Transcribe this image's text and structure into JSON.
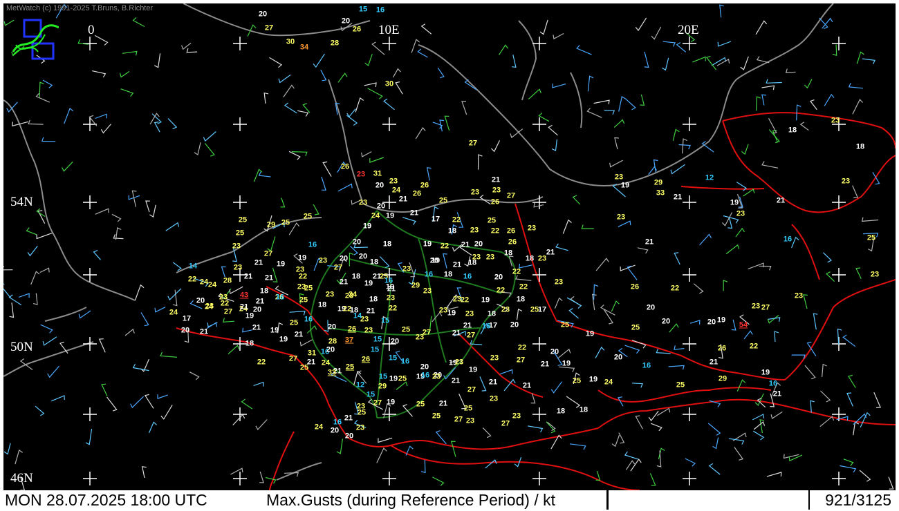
{
  "credit": "MetWatch  (c) 1991-2025 T.Bruns, B.Richter",
  "footer": {
    "datetime": "MON 28.07.2025 18:00 UTC",
    "parameter": "Max.Gusts (during Reference Period) / kt",
    "station_count": "921/3125"
  },
  "grid_labels": {
    "lon_0": "0",
    "lon_10e": "10E",
    "lon_20e": "20E",
    "lat_54n": "54N",
    "lat_50n": "50N",
    "lat_46n": "46N"
  },
  "legend_colors": {
    "below_20": "#ffffff",
    "20_to_34": "#ffff66",
    "34_to_48": "#ff9933",
    "48_plus": "#ff3333",
    "calm_marine": "#33ccff"
  },
  "observations": [
    {
      "v": "20",
      "c": "w"
    },
    {
      "v": "27",
      "c": "y"
    },
    {
      "v": "30",
      "c": "y"
    },
    {
      "v": "34",
      "c": "o"
    },
    {
      "v": "28",
      "c": "y"
    },
    {
      "v": "20",
      "c": "w"
    },
    {
      "v": "26",
      "c": "y"
    },
    {
      "v": "15",
      "c": "c"
    },
    {
      "v": "16",
      "c": "c"
    },
    {
      "v": "30",
      "c": "y"
    },
    {
      "v": "27",
      "c": "y"
    },
    {
      "v": "26",
      "c": "y"
    },
    {
      "v": "23",
      "c": "r"
    },
    {
      "v": "31",
      "c": "y"
    },
    {
      "v": "20",
      "c": "w"
    },
    {
      "v": "23",
      "c": "y"
    },
    {
      "v": "24",
      "c": "y"
    },
    {
      "v": "26",
      "c": "y"
    },
    {
      "v": "26",
      "c": "y"
    },
    {
      "v": "21",
      "c": "w"
    },
    {
      "v": "23",
      "c": "y"
    },
    {
      "v": "23",
      "c": "y"
    },
    {
      "v": "27",
      "c": "y"
    },
    {
      "v": "25",
      "c": "y"
    },
    {
      "v": "21",
      "c": "w"
    },
    {
      "v": "23",
      "c": "y"
    },
    {
      "v": "20",
      "c": "w"
    },
    {
      "v": "24",
      "c": "y"
    },
    {
      "v": "19",
      "c": "w"
    },
    {
      "v": "21",
      "c": "w"
    },
    {
      "v": "26",
      "c": "y"
    },
    {
      "v": "23",
      "c": "y"
    },
    {
      "v": "19",
      "c": "w"
    },
    {
      "v": "29",
      "c": "y"
    },
    {
      "v": "33",
      "c": "y"
    },
    {
      "v": "21",
      "c": "w"
    },
    {
      "v": "12",
      "c": "c"
    },
    {
      "v": "18",
      "c": "w"
    },
    {
      "v": "23",
      "c": "y"
    },
    {
      "v": "18",
      "c": "w"
    },
    {
      "v": "23",
      "c": "y"
    },
    {
      "v": "19",
      "c": "w"
    },
    {
      "v": "23",
      "c": "y"
    },
    {
      "v": "21",
      "c": "w"
    },
    {
      "v": "25",
      "c": "y"
    },
    {
      "v": "25",
      "c": "y"
    },
    {
      "v": "29",
      "c": "y"
    },
    {
      "v": "25",
      "c": "y"
    },
    {
      "v": "25",
      "c": "y"
    },
    {
      "v": "23",
      "c": "y"
    },
    {
      "v": "20",
      "c": "w"
    },
    {
      "v": "19",
      "c": "w"
    },
    {
      "v": "17",
      "c": "w"
    },
    {
      "v": "22",
      "c": "y"
    },
    {
      "v": "25",
      "c": "y"
    },
    {
      "v": "18",
      "c": "w"
    },
    {
      "v": "23",
      "c": "y"
    },
    {
      "v": "22",
      "c": "y"
    },
    {
      "v": "26",
      "c": "y"
    },
    {
      "v": "23",
      "c": "y"
    },
    {
      "v": "16",
      "c": "c"
    },
    {
      "v": "20",
      "c": "w"
    },
    {
      "v": "18",
      "c": "w"
    },
    {
      "v": "19",
      "c": "w"
    },
    {
      "v": "22",
      "c": "y"
    },
    {
      "v": "21",
      "c": "w"
    },
    {
      "v": "20",
      "c": "w"
    },
    {
      "v": "26",
      "c": "y"
    },
    {
      "v": "21",
      "c": "w"
    },
    {
      "v": "21",
      "c": "w"
    },
    {
      "v": "16",
      "c": "c"
    },
    {
      "v": "25",
      "c": "y"
    },
    {
      "v": "14",
      "c": "c"
    },
    {
      "v": "23",
      "c": "y"
    },
    {
      "v": "27",
      "c": "y"
    },
    {
      "v": "21",
      "c": "w"
    },
    {
      "v": "19",
      "c": "w"
    },
    {
      "v": "19",
      "c": "w"
    },
    {
      "v": "23",
      "c": "y"
    },
    {
      "v": "27",
      "c": "y"
    },
    {
      "v": "20",
      "c": "w"
    },
    {
      "v": "18",
      "c": "w"
    },
    {
      "v": "23",
      "c": "y"
    },
    {
      "v": "20",
      "c": "w"
    },
    {
      "v": "21",
      "c": "w"
    },
    {
      "v": "23",
      "c": "y"
    },
    {
      "v": "18",
      "c": "w"
    },
    {
      "v": "18",
      "c": "w"
    },
    {
      "v": "18",
      "c": "w"
    },
    {
      "v": "23",
      "c": "y"
    },
    {
      "v": "21",
      "c": "w"
    },
    {
      "v": "21",
      "c": "w"
    },
    {
      "v": "28",
      "c": "y"
    },
    {
      "v": "22",
      "c": "y"
    },
    {
      "v": "24",
      "c": "y"
    },
    {
      "v": "24",
      "c": "y"
    },
    {
      "v": "18",
      "c": "w"
    },
    {
      "v": "22",
      "c": "y"
    },
    {
      "v": "26",
      "c": "y"
    },
    {
      "v": "23",
      "c": "y"
    },
    {
      "v": "21",
      "c": "w"
    },
    {
      "v": "23",
      "c": "y"
    },
    {
      "v": "25",
      "c": "y"
    },
    {
      "v": "23",
      "c": "y"
    },
    {
      "v": "25",
      "c": "y"
    },
    {
      "v": "23",
      "c": "y"
    },
    {
      "v": "18",
      "c": "w"
    },
    {
      "v": "19",
      "c": "w"
    },
    {
      "v": "16",
      "c": "c"
    },
    {
      "v": "21",
      "c": "w"
    },
    {
      "v": "21",
      "c": "w"
    },
    {
      "v": "16",
      "c": "c"
    },
    {
      "v": "18",
      "c": "w"
    },
    {
      "v": "16",
      "c": "c"
    },
    {
      "v": "20",
      "c": "w"
    },
    {
      "v": "22",
      "c": "y"
    },
    {
      "v": "22",
      "c": "y"
    },
    {
      "v": "23",
      "c": "y"
    },
    {
      "v": "23",
      "c": "y"
    },
    {
      "v": "25",
      "c": "y"
    },
    {
      "v": "26",
      "c": "y"
    },
    {
      "v": "22",
      "c": "y"
    },
    {
      "v": "20",
      "c": "w"
    },
    {
      "v": "27",
      "c": "y"
    },
    {
      "v": "23",
      "c": "y"
    },
    {
      "v": "23",
      "c": "y"
    },
    {
      "v": "20",
      "c": "w"
    },
    {
      "v": "20",
      "c": "w"
    },
    {
      "v": "25",
      "c": "y"
    },
    {
      "v": "54",
      "c": "r",
      "u": true
    },
    {
      "v": "23",
      "c": "y"
    },
    {
      "v": "19",
      "c": "w"
    },
    {
      "v": "19",
      "c": "w"
    },
    {
      "v": "23",
      "c": "y"
    },
    {
      "v": "18",
      "c": "w"
    },
    {
      "v": "19",
      "c": "w"
    },
    {
      "v": "18",
      "c": "w"
    },
    {
      "v": "25",
      "c": "y"
    },
    {
      "v": "24",
      "c": "y"
    },
    {
      "v": "29",
      "c": "y"
    },
    {
      "v": "23",
      "c": "y"
    },
    {
      "v": "22",
      "c": "y"
    },
    {
      "v": "18",
      "c": "w"
    },
    {
      "v": "25",
      "c": "y"
    },
    {
      "v": "23",
      "c": "y"
    },
    {
      "v": "17",
      "c": "w"
    },
    {
      "v": "23",
      "c": "y"
    },
    {
      "v": "23",
      "c": "y"
    },
    {
      "v": "19",
      "c": "w"
    },
    {
      "v": "18",
      "c": "w"
    },
    {
      "v": "16",
      "c": "c"
    },
    {
      "v": "24",
      "c": "y"
    },
    {
      "v": "20",
      "c": "w"
    },
    {
      "v": "22",
      "c": "y"
    },
    {
      "v": "21",
      "c": "w"
    },
    {
      "v": "22",
      "c": "y"
    },
    {
      "v": "23",
      "c": "y"
    },
    {
      "v": "15",
      "c": "c"
    },
    {
      "v": "14",
      "c": "c"
    },
    {
      "v": "22",
      "c": "y"
    },
    {
      "v": "23",
      "c": "y"
    },
    {
      "v": "19",
      "c": "w"
    },
    {
      "v": "18",
      "c": "w"
    },
    {
      "v": "17",
      "c": "w"
    },
    {
      "v": "20",
      "c": "w"
    },
    {
      "v": "16",
      "c": "c"
    },
    {
      "v": "21",
      "c": "w"
    },
    {
      "v": "21",
      "c": "w"
    },
    {
      "v": "27",
      "c": "y"
    },
    {
      "v": "25",
      "c": "y"
    },
    {
      "v": "27",
      "c": "y"
    },
    {
      "v": "23",
      "c": "y"
    },
    {
      "v": "20",
      "c": "w"
    },
    {
      "v": "15",
      "c": "c"
    },
    {
      "v": "23",
      "c": "y"
    },
    {
      "v": "26",
      "c": "y",
      "u": true
    },
    {
      "v": "20",
      "c": "w"
    },
    {
      "v": "16",
      "c": "c"
    },
    {
      "v": "25",
      "c": "y"
    },
    {
      "v": "21",
      "c": "w"
    },
    {
      "v": "19",
      "c": "w"
    },
    {
      "v": "21",
      "c": "w"
    },
    {
      "v": "19",
      "c": "w"
    },
    {
      "v": "18",
      "c": "w"
    },
    {
      "v": "21",
      "c": "w"
    },
    {
      "v": "20",
      "c": "w"
    },
    {
      "v": "17",
      "c": "w"
    },
    {
      "v": "24",
      "c": "y"
    },
    {
      "v": "23",
      "c": "y"
    },
    {
      "v": "27",
      "c": "y"
    },
    {
      "v": "23",
      "c": "y"
    },
    {
      "v": "43",
      "c": "r",
      "u": true
    },
    {
      "v": "21",
      "c": "w"
    },
    {
      "v": "21",
      "c": "w"
    },
    {
      "v": "20",
      "c": "w"
    },
    {
      "v": "24",
      "c": "y"
    },
    {
      "v": "22",
      "c": "y"
    },
    {
      "v": "19",
      "c": "w"
    },
    {
      "v": "22",
      "c": "y"
    },
    {
      "v": "27",
      "c": "y"
    },
    {
      "v": "25",
      "c": "y"
    },
    {
      "v": "31",
      "c": "y"
    },
    {
      "v": "16",
      "c": "c"
    },
    {
      "v": "21",
      "c": "w"
    },
    {
      "v": "20",
      "c": "w"
    },
    {
      "v": "28",
      "c": "y"
    },
    {
      "v": "24",
      "c": "y"
    },
    {
      "v": "37",
      "c": "o",
      "u": true
    },
    {
      "v": "26",
      "c": "y",
      "u": true
    },
    {
      "v": "15",
      "c": "c"
    },
    {
      "v": "15",
      "c": "c"
    },
    {
      "v": "20",
      "c": "w"
    },
    {
      "v": "16",
      "c": "c"
    },
    {
      "v": "19",
      "c": "w"
    },
    {
      "v": "15",
      "c": "c"
    },
    {
      "v": "12",
      "c": "c"
    },
    {
      "v": "25",
      "c": "y",
      "u": true
    },
    {
      "v": "21",
      "c": "w"
    },
    {
      "v": "33",
      "c": "y",
      "u": true
    },
    {
      "v": "15",
      "c": "c"
    },
    {
      "v": "29",
      "c": "y"
    },
    {
      "v": "25",
      "c": "y"
    },
    {
      "v": "20",
      "c": "w"
    },
    {
      "v": "19",
      "c": "w"
    },
    {
      "v": "19",
      "c": "w"
    },
    {
      "v": "23",
      "c": "y"
    },
    {
      "v": "22",
      "c": "y"
    },
    {
      "v": "27",
      "c": "y"
    },
    {
      "v": "20",
      "c": "w"
    },
    {
      "v": "21",
      "c": "w"
    },
    {
      "v": "19",
      "c": "w"
    },
    {
      "v": "19",
      "c": "w"
    },
    {
      "v": "25",
      "c": "y"
    },
    {
      "v": "24",
      "c": "y"
    },
    {
      "v": "16",
      "c": "c"
    },
    {
      "v": "20",
      "c": "w"
    },
    {
      "v": "21",
      "c": "w"
    },
    {
      "v": "26",
      "c": "y"
    },
    {
      "v": "22",
      "c": "y"
    },
    {
      "v": "25",
      "c": "y"
    },
    {
      "v": "29",
      "c": "y"
    },
    {
      "v": "21",
      "c": "w"
    },
    {
      "v": "16",
      "c": "c"
    },
    {
      "v": "19",
      "c": "w"
    },
    {
      "v": "19",
      "c": "w"
    },
    {
      "v": "23",
      "c": "y"
    },
    {
      "v": "19",
      "c": "w"
    },
    {
      "v": "21",
      "c": "w"
    },
    {
      "v": "27",
      "c": "y"
    },
    {
      "v": "21",
      "c": "w"
    },
    {
      "v": "25",
      "c": "y"
    },
    {
      "v": "23",
      "c": "y"
    },
    {
      "v": "23",
      "c": "y"
    },
    {
      "v": "27",
      "c": "y"
    },
    {
      "v": "18",
      "c": "w"
    },
    {
      "v": "18",
      "c": "w"
    },
    {
      "v": "23",
      "c": "y"
    },
    {
      "v": "21",
      "c": "w"
    },
    {
      "v": "19",
      "c": "w"
    },
    {
      "v": "23",
      "c": "y"
    },
    {
      "v": "16",
      "c": "c"
    },
    {
      "v": "25",
      "c": "y"
    },
    {
      "v": "21",
      "c": "w"
    },
    {
      "v": "25",
      "c": "y"
    },
    {
      "v": "27",
      "c": "y"
    },
    {
      "v": "23",
      "c": "y"
    },
    {
      "v": "27",
      "c": "y"
    },
    {
      "v": "19",
      "c": "w"
    },
    {
      "v": "23",
      "c": "y"
    },
    {
      "v": "25",
      "c": "y"
    },
    {
      "v": "16",
      "c": "c"
    },
    {
      "v": "20",
      "c": "w"
    },
    {
      "v": "21",
      "c": "w"
    },
    {
      "v": "24",
      "c": "y"
    },
    {
      "v": "20",
      "c": "w"
    },
    {
      "v": "23",
      "c": "y"
    }
  ]
}
